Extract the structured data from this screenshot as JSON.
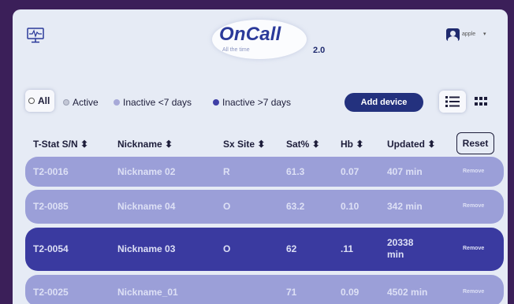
{
  "header": {
    "logo_title": "OnCall",
    "logo_tagline": "All the time",
    "logo_version": "2.0",
    "user_name": "apple",
    "user_menu_chevron": "▾",
    "icons": {
      "monitor": "monitor-icon",
      "avatar": "user-avatar-icon"
    }
  },
  "filters": {
    "all": "All",
    "active": "Active",
    "inactive_lt7": "Inactive <7 days",
    "inactive_gt7": "Inactive >7 days"
  },
  "toolbar": {
    "add_device": "Add device",
    "icons": {
      "list_view": "list-view-icon",
      "grid_view": "grid-view-icon"
    }
  },
  "table": {
    "headers": {
      "serial": "T-Stat S/N",
      "nickname": "Nickname",
      "site": "Sx Site",
      "sat": "Sat%",
      "hb": "Hb",
      "updated": "Updated"
    },
    "sort_glyph": "⬍",
    "reset_label": "Reset",
    "rows": [
      {
        "serial": "T2-0016",
        "nickname": "Nickname 02",
        "site": "R",
        "sat": "61.3",
        "hb": "0.07",
        "updated": "407 min",
        "action": "Remove",
        "status": "inactive-lt7"
      },
      {
        "serial": "T2-0085",
        "nickname": "Nickname 04",
        "site": "O",
        "sat": "63.2",
        "hb": "0.10",
        "updated": "342 min",
        "action": "Remove",
        "status": "inactive-lt7"
      },
      {
        "serial": "T2-0054",
        "nickname": "Nickname 03",
        "site": "O",
        "sat": "62",
        "hb": ".11",
        "updated_line1": "20338",
        "updated_line2": "min",
        "action": "Remove",
        "status": "inactive-gt7"
      },
      {
        "serial": "T2-0025",
        "nickname": "Nickname_01",
        "site": "",
        "sat": "71",
        "hb": "0.09",
        "updated": "4502 min",
        "action": "Remove",
        "status": "inactive-lt7"
      }
    ]
  },
  "colors": {
    "frame": "#3b1f59",
    "panel": "#e6ebf5",
    "accent": "#23317e",
    "row_inactive_lt7": "#9b9fd8",
    "row_inactive_gt7": "#3a3aa0"
  }
}
